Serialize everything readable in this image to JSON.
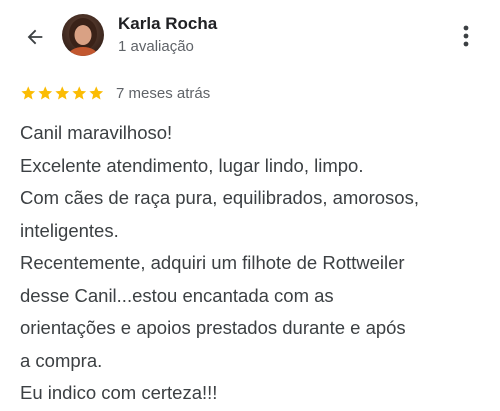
{
  "reviewer": {
    "name": "Karla Rocha",
    "review_count": "1 avaliação",
    "avatar_icon": "avatar-photo"
  },
  "header": {
    "back_icon": "arrow-back-icon",
    "more_icon": "more-vert-icon"
  },
  "rating": {
    "stars": 5,
    "max_stars": 5,
    "star_color": "#fbbc04",
    "time_ago": "7 meses atrás"
  },
  "review": {
    "lines": [
      "Canil maravilhoso!",
      "Excelente atendimento, lugar lindo, limpo.",
      "Com cães de raça pura, equilibrados, amorosos,",
      "inteligentes.",
      "Recentemente, adquiri um filhote de Rottweiler",
      "desse Canil...estou encantada com as",
      "orientações e apoios prestados durante e após",
      "a compra.",
      "Eu indico com certeza!!!"
    ]
  }
}
